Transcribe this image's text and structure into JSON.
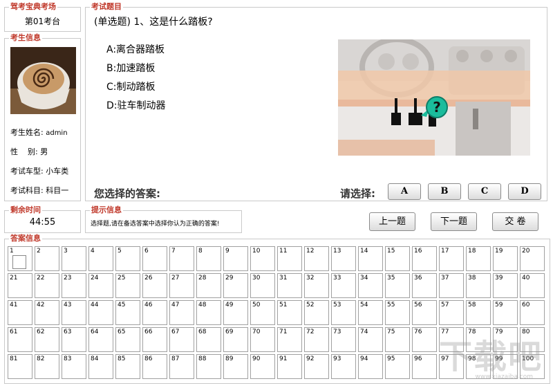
{
  "exam_room": {
    "title": "驾考宝典考场",
    "station": "第01考台"
  },
  "examinee": {
    "title": "考生信息",
    "name_label": "考生姓名:",
    "name_value": "admin",
    "gender_label": "性    别:",
    "gender_value": "男",
    "car_label": "考试车型:",
    "car_value": "小车类",
    "subject_label": "考试科目:",
    "subject_value": "科目一"
  },
  "question": {
    "title": "考试题目",
    "text": "(单选题) 1、这是什么踏板?",
    "options": [
      "A:离合器踏板",
      "B:加速踏板",
      "C:制动踏板",
      "D:驻车制动器"
    ],
    "picture_marker": "?",
    "answer_label": "您选择的答案:",
    "answer_value": "",
    "choose_label": "请选择:",
    "choice_buttons": [
      "A",
      "B",
      "C",
      "D"
    ]
  },
  "timer": {
    "title": "剩余时间",
    "value": "44:55"
  },
  "hint": {
    "title": "提示信息",
    "text": "选择题,请在备选答案中选择你认为正确的答案!"
  },
  "nav": {
    "prev": "上一题",
    "next": "下一题",
    "submit": "交 卷"
  },
  "answers": {
    "title": "答案信息",
    "numbers": [
      "1",
      "2",
      "3",
      "4",
      "5",
      "6",
      "7",
      "8",
      "9",
      "10",
      "11",
      "12",
      "13",
      "14",
      "15",
      "16",
      "17",
      "18",
      "19",
      "20",
      "21",
      "22",
      "23",
      "24",
      "25",
      "26",
      "27",
      "28",
      "29",
      "30",
      "31",
      "32",
      "33",
      "34",
      "35",
      "36",
      "37",
      "38",
      "39",
      "40",
      "41",
      "42",
      "43",
      "44",
      "45",
      "46",
      "47",
      "48",
      "49",
      "50",
      "51",
      "52",
      "53",
      "54",
      "55",
      "56",
      "57",
      "58",
      "59",
      "60",
      "61",
      "62",
      "63",
      "64",
      "65",
      "66",
      "67",
      "68",
      "69",
      "70",
      "71",
      "72",
      "73",
      "74",
      "75",
      "76",
      "77",
      "78",
      "79",
      "80",
      "81",
      "82",
      "83",
      "84",
      "85",
      "86",
      "87",
      "88",
      "89",
      "90",
      "91",
      "92",
      "93",
      "94",
      "95",
      "96",
      "97",
      "98",
      "99",
      "100"
    ]
  },
  "watermark": {
    "text": "下载吧",
    "sub": "www.xiazaiba.com"
  },
  "colors": {
    "legend": "#c0392b",
    "marker": "#1abc9c"
  }
}
